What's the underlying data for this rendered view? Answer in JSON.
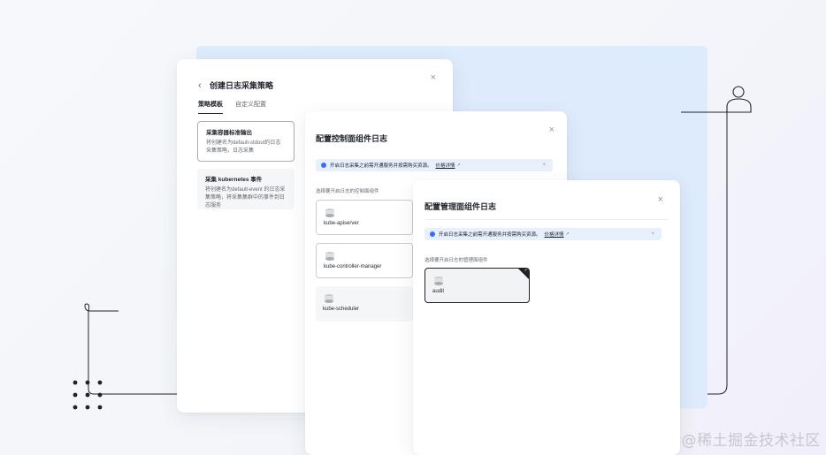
{
  "colors": {
    "accent": "#3370ff",
    "background_panel": "#deebfd",
    "text_primary": "#1f2329",
    "text_secondary": "#646a73"
  },
  "policy_dialog": {
    "back_icon": "chevron-left-icon",
    "title": "创建日志采集策略",
    "close_icon": "close-icon",
    "tabs": [
      {
        "label": "策略模板",
        "active": true
      },
      {
        "label": "自定义配置",
        "active": false
      }
    ],
    "strategies": [
      {
        "title": "采集容器标准输出",
        "desc": "将创建名为default-stdout的日志采集策略，日志采集"
      },
      {
        "title": "采集 kubernetes 事件",
        "desc": "将创建名为default-event 的日志采集策略，将采集集群中的事件到日志服务"
      }
    ]
  },
  "control_plane_dialog": {
    "title": "配置控制面组件日志",
    "close_icon": "close-icon",
    "banner": {
      "text": "开启日志采集之前需开通服务并按需购买资源。",
      "link": "价格详情",
      "close_icon": "close-icon"
    },
    "section_label": "选择要开启日志的控制面组件",
    "components": [
      {
        "name": "kube-apiserver",
        "icon": "component-icon"
      },
      {
        "name": "kube-controller-manager",
        "icon": "component-icon"
      },
      {
        "name": "kube-scheduler",
        "icon": "component-icon"
      }
    ]
  },
  "management_dialog": {
    "title": "配置管理面组件日志",
    "close_icon": "close-icon",
    "banner": {
      "text": "开启日志采集之前需开通服务并按需购买资源。",
      "link": "价格详情",
      "close_icon": "close-icon"
    },
    "section_label": "选择要开启日志的管理面组件",
    "components": [
      {
        "name": "audit",
        "icon": "component-icon",
        "selected": true
      }
    ]
  },
  "decorations": {
    "user_icon": "user-icon",
    "dots_icon": "dot-grid-icon"
  },
  "watermark": "@稀土掘金技术社区"
}
